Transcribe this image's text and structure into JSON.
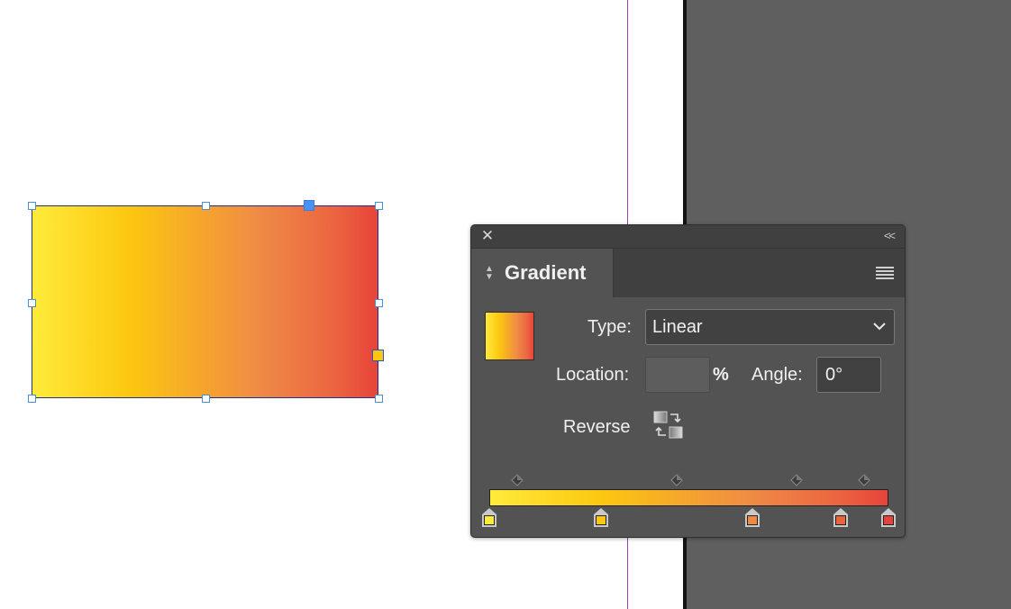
{
  "colors": {
    "yellow": "#ffeb3b",
    "gold": "#fcc70f",
    "orange": "#ef8a45",
    "red_orange": "#eb6440",
    "red": "#e8433a"
  },
  "panel": {
    "title": "Gradient",
    "close_icon": "close-icon",
    "collapse_label": "<<",
    "menu_icon": "panel-menu-icon",
    "type_label": "Type:",
    "type_value": "Linear",
    "location_label": "Location:",
    "location_value": "",
    "percent_label": "%",
    "angle_label": "Angle:",
    "angle_value": "0°",
    "reverse_label": "Reverse",
    "reverse_icon": "reverse-gradient-icon",
    "stops": [
      {
        "location_percent": 0,
        "color": "#ffeb3b"
      },
      {
        "location_percent": 28,
        "color": "#fcc70f"
      },
      {
        "location_percent": 66,
        "color": "#ef8a45"
      },
      {
        "location_percent": 88,
        "color": "#eb6440"
      },
      {
        "location_percent": 100,
        "color": "#e8433a"
      }
    ],
    "midpoints_percent": [
      7,
      47,
      77,
      94
    ]
  }
}
